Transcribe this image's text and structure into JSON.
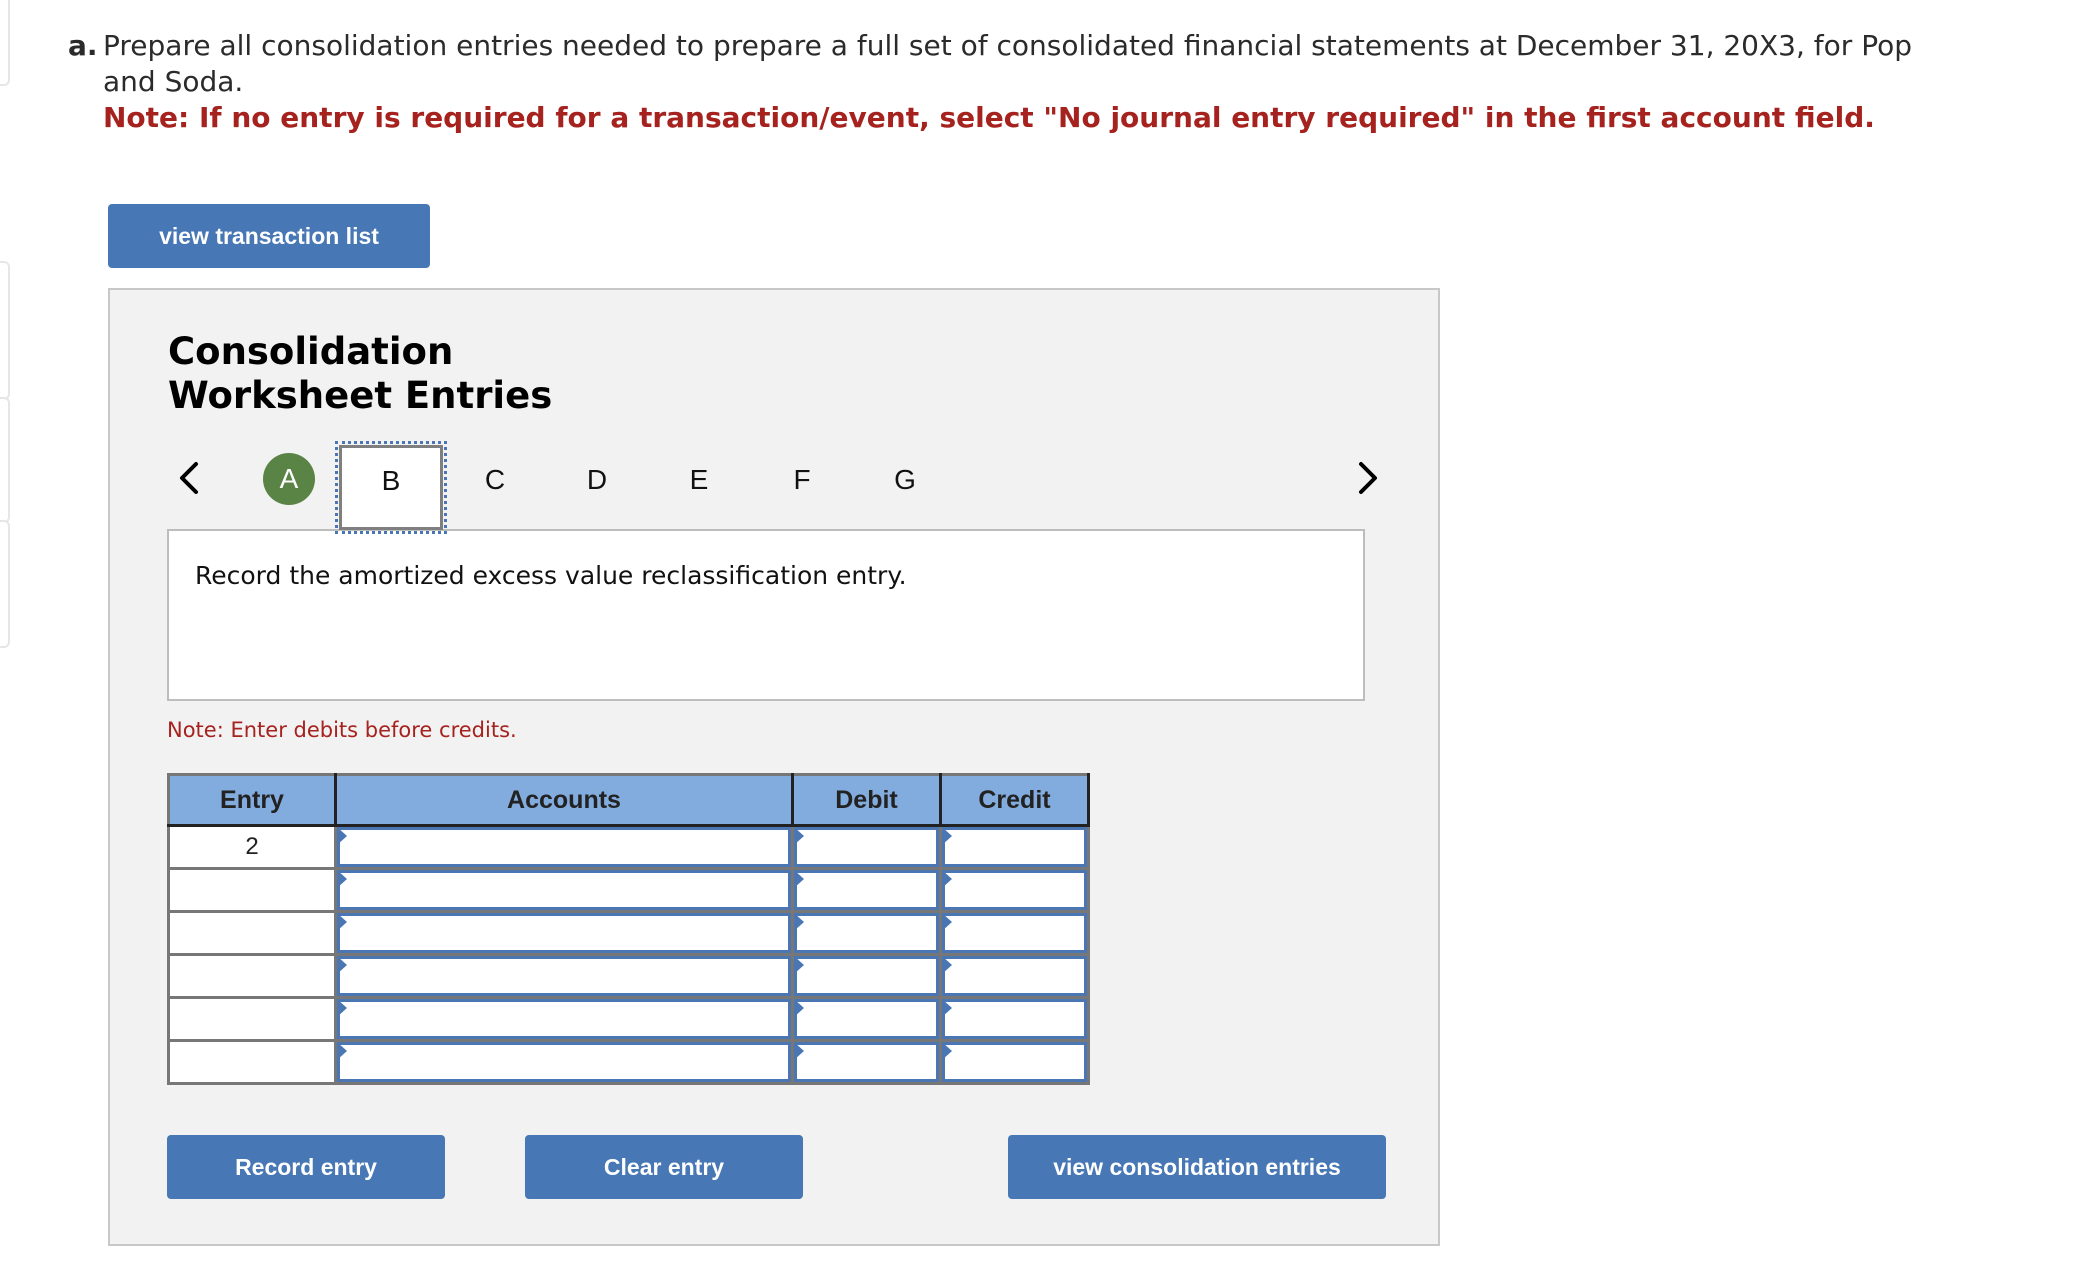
{
  "question": {
    "label": "a.",
    "text": "Prepare all consolidation entries needed to prepare a full set of consolidated financial statements at December 31, 20X3, for Pop and Soda.",
    "note": "Note: If no entry is required for a transaction/event, select \"No journal entry required\" in the first account field."
  },
  "buttons": {
    "view_transaction_list": "view transaction list",
    "record_entry": "Record entry",
    "clear_entry": "Clear entry",
    "view_consolidation_entries": "view consolidation entries"
  },
  "panel": {
    "title_line1": "Consolidation",
    "title_line2": "Worksheet Entries",
    "nav": {
      "prev_icon": "chevron-left-icon",
      "next_icon": "chevron-right-icon",
      "tabs": [
        {
          "label": "A",
          "state": "completed"
        },
        {
          "label": "B",
          "state": "active"
        },
        {
          "label": "C",
          "state": "pending"
        },
        {
          "label": "D",
          "state": "pending"
        },
        {
          "label": "E",
          "state": "pending"
        },
        {
          "label": "F",
          "state": "pending"
        },
        {
          "label": "G",
          "state": "pending"
        }
      ]
    },
    "instruction": "Record the amortized excess value reclassification entry.",
    "note": "Note: Enter debits before credits.",
    "colors": {
      "completed_tab": "#5a8346",
      "header_bg": "#82abde",
      "button_bg": "#4777b4",
      "note_red": "#a6221e"
    }
  },
  "table": {
    "headers": [
      "Entry",
      "Accounts",
      "Debit",
      "Credit"
    ],
    "rows": [
      {
        "entry": "2",
        "account": "",
        "debit": "",
        "credit": ""
      },
      {
        "entry": "",
        "account": "",
        "debit": "",
        "credit": ""
      },
      {
        "entry": "",
        "account": "",
        "debit": "",
        "credit": ""
      },
      {
        "entry": "",
        "account": "",
        "debit": "",
        "credit": ""
      },
      {
        "entry": "",
        "account": "",
        "debit": "",
        "credit": ""
      },
      {
        "entry": "",
        "account": "",
        "debit": "",
        "credit": ""
      }
    ]
  }
}
